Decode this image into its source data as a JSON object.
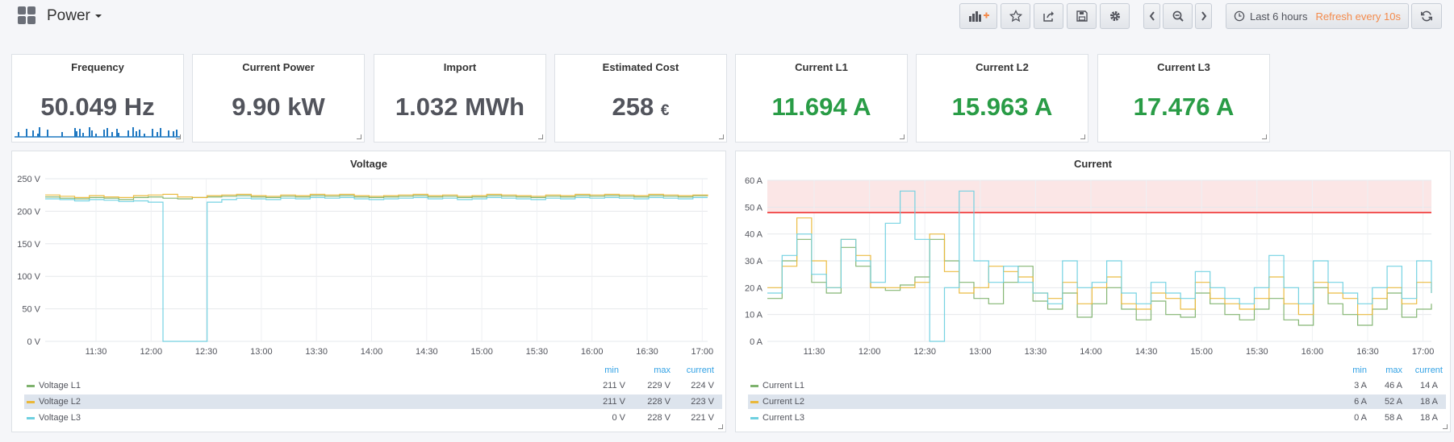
{
  "navbar": {
    "title": "Power",
    "time_range": "Last 6 hours",
    "refresh": "Refresh every 10s",
    "icons": [
      "add-panel-icon",
      "star-icon",
      "share-icon",
      "save-icon",
      "settings-icon",
      "chevron-left-icon",
      "zoom-out-icon",
      "chevron-right-icon",
      "clock-icon",
      "refresh-icon"
    ]
  },
  "stats": [
    {
      "title": "Frequency",
      "value": "50.049",
      "unit": "Hz",
      "color": "#52545c"
    },
    {
      "title": "Current Power",
      "value": "9.90",
      "unit": "kW",
      "color": "#52545c"
    },
    {
      "title": "Import",
      "value": "1.032",
      "unit": "MWh",
      "color": "#52545c"
    },
    {
      "title": "Estimated Cost",
      "value": "258",
      "unit": "€",
      "color": "#52545c"
    },
    {
      "title": "Current L1",
      "value": "11.694",
      "unit": "A",
      "color": "#299c46"
    },
    {
      "title": "Current L2",
      "value": "15.963",
      "unit": "A",
      "color": "#299c46"
    },
    {
      "title": "Current L3",
      "value": "17.476",
      "unit": "A",
      "color": "#299c46"
    }
  ],
  "colors": {
    "l1": "#7eb26d",
    "l2": "#eab839",
    "l3": "#6ed0e0",
    "threshold": "#f25454",
    "threshold_fill": "#fbe6e6",
    "sparkline": "#1f78c1"
  },
  "legend_headers": {
    "min": "min",
    "max": "max",
    "current": "current"
  },
  "chart_data": [
    {
      "type": "line",
      "title": "Voltage",
      "xlabel": "",
      "ylabel": "",
      "x_ticks": [
        "11:30",
        "12:00",
        "12:30",
        "13:00",
        "13:30",
        "14:00",
        "14:30",
        "15:00",
        "15:30",
        "16:00",
        "16:30",
        "17:00"
      ],
      "y_ticks": [
        "250 V",
        "200 V",
        "150 V",
        "100 V",
        "50 V",
        "0 V"
      ],
      "ylim": [
        0,
        250
      ],
      "grid": true,
      "legend_position": "bottom",
      "series": [
        {
          "name": "Voltage L1",
          "min": "211 V",
          "max": "229 V",
          "current": "224 V",
          "values": [
            222,
            220,
            219,
            221,
            220,
            218,
            221,
            222,
            220,
            219,
            221,
            222,
            223,
            224,
            222,
            221,
            223,
            222,
            224,
            223,
            224,
            222,
            221,
            222,
            223,
            224,
            222,
            223,
            221,
            222,
            224,
            223,
            222,
            221,
            223,
            222,
            224,
            223,
            224,
            223,
            222,
            224,
            223,
            222,
            224,
            224
          ]
        },
        {
          "name": "Voltage L2",
          "min": "211 V",
          "max": "228 V",
          "current": "223 V",
          "values": [
            225,
            223,
            221,
            224,
            222,
            221,
            224,
            225,
            226,
            222,
            221,
            224,
            225,
            226,
            224,
            223,
            225,
            224,
            226,
            225,
            226,
            224,
            223,
            224,
            225,
            226,
            224,
            225,
            223,
            224,
            226,
            225,
            224,
            223,
            225,
            224,
            226,
            225,
            226,
            225,
            224,
            226,
            225,
            224,
            225,
            223
          ]
        },
        {
          "name": "Voltage L3",
          "min": "0 V",
          "max": "228 V",
          "current": "221 V",
          "values": [
            219,
            218,
            216,
            218,
            217,
            215,
            216,
            214,
            0,
            0,
            0,
            214,
            218,
            220,
            219,
            218,
            220,
            219,
            221,
            220,
            221,
            219,
            218,
            219,
            220,
            221,
            219,
            220,
            218,
            219,
            221,
            220,
            219,
            218,
            220,
            219,
            221,
            220,
            221,
            220,
            219,
            221,
            220,
            219,
            221,
            221
          ]
        }
      ]
    },
    {
      "type": "line",
      "title": "Current",
      "xlabel": "",
      "ylabel": "",
      "x_ticks": [
        "11:30",
        "12:00",
        "12:30",
        "13:00",
        "13:30",
        "14:00",
        "14:30",
        "15:00",
        "15:30",
        "16:00",
        "16:30",
        "17:00"
      ],
      "y_ticks": [
        "60 A",
        "50 A",
        "40 A",
        "30 A",
        "20 A",
        "10 A",
        "0 A"
      ],
      "ylim": [
        0,
        60
      ],
      "threshold": 48,
      "grid": true,
      "legend_position": "bottom",
      "series": [
        {
          "name": "Current L1",
          "min": "3 A",
          "max": "46 A",
          "current": "14 A",
          "values": [
            16,
            30,
            38,
            22,
            18,
            35,
            28,
            20,
            19,
            21,
            24,
            38,
            30,
            22,
            16,
            14,
            22,
            28,
            15,
            12,
            18,
            9,
            14,
            20,
            12,
            8,
            15,
            10,
            9,
            18,
            14,
            10,
            8,
            12,
            16,
            8,
            6,
            20,
            14,
            10,
            6,
            12,
            18,
            9,
            12,
            14
          ]
        },
        {
          "name": "Current L2",
          "min": "6 A",
          "max": "52 A",
          "current": "18 A",
          "values": [
            20,
            28,
            46,
            30,
            20,
            38,
            32,
            20,
            20,
            20,
            22,
            40,
            26,
            18,
            20,
            28,
            26,
            24,
            18,
            16,
            22,
            14,
            20,
            24,
            14,
            12,
            18,
            16,
            12,
            22,
            16,
            14,
            12,
            16,
            24,
            14,
            10,
            22,
            18,
            16,
            10,
            16,
            20,
            14,
            22,
            18
          ]
        },
        {
          "name": "Current L3",
          "min": "0 A",
          "max": "58 A",
          "current": "18 A",
          "values": [
            18,
            32,
            40,
            25,
            20,
            38,
            30,
            22,
            44,
            56,
            38,
            0,
            20,
            56,
            30,
            22,
            28,
            22,
            18,
            14,
            30,
            20,
            22,
            30,
            18,
            14,
            22,
            18,
            16,
            26,
            20,
            16,
            14,
            20,
            32,
            20,
            14,
            30,
            22,
            18,
            14,
            20,
            28,
            16,
            30,
            18
          ]
        }
      ]
    }
  ]
}
